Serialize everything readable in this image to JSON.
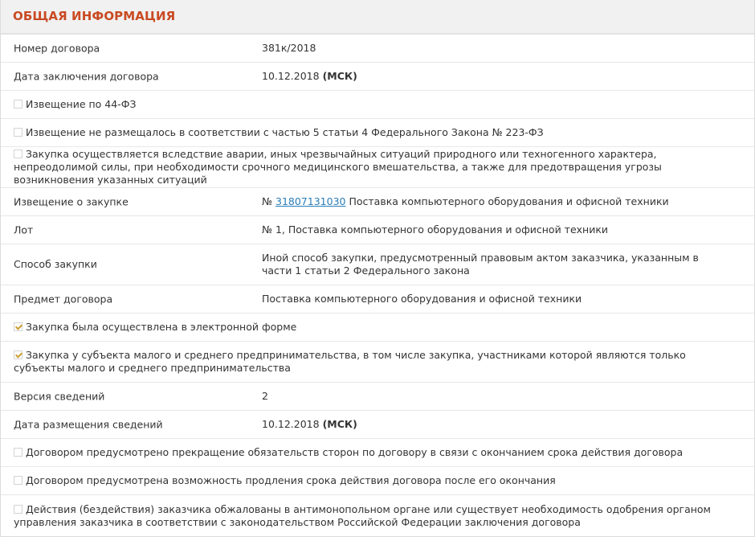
{
  "header": {
    "title": "ОБЩАЯ ИНФОРМАЦИЯ"
  },
  "rows": {
    "contract_number": {
      "label": "Номер договора",
      "value": "381к/2018"
    },
    "contract_date": {
      "label": "Дата заключения договора",
      "date": "10.12.2018",
      "tz": "(МСК)"
    },
    "notice_44": {
      "text": "Извещение по 44-ФЗ",
      "checked": false
    },
    "notice_not_posted": {
      "text": "Извещение не размещалось в соответствии с частью 5 статьи 4 Федерального Закона № 223-ФЗ",
      "checked": false
    },
    "emergency": {
      "text": "Закупка осуществляется вследствие аварии, иных чрезвычайных ситуаций природного или техногенного характера, непреодолимой силы, при необходимости срочного медицинского вмешательства, а также для предотвращения угрозы возникновения указанных ситуаций",
      "checked": false
    },
    "purchase_notice": {
      "label": "Извещение о закупке",
      "prefix": "№",
      "link": "31807131030",
      "text": "Поставка компьютерного оборудования и офисной техники"
    },
    "lot": {
      "label": "Лот",
      "value": "№ 1, Поставка компьютерного оборудования и офисной техники"
    },
    "method": {
      "label": "Способ закупки",
      "value": "Иной способ закупки, предусмотренный правовым актом заказчика, указанным в части 1 статьи 2 Федерального закона"
    },
    "subject": {
      "label": "Предмет договора",
      "value": "Поставка компьютерного оборудования и офисной техники"
    },
    "electronic": {
      "text": "Закупка была осуществлена в электронной форме",
      "checked": true
    },
    "sme": {
      "text": "Закупка у субъекта малого и среднего предпринимательства, в том числе закупка, участниками которой являются только субъекты малого и среднего предпринимательства",
      "checked": true
    },
    "version": {
      "label": "Версия сведений",
      "value": "2"
    },
    "posting_date": {
      "label": "Дата размещения сведений",
      "date": "10.12.2018",
      "tz": "(МСК)"
    },
    "termination": {
      "text": "Договором предусмотрено прекращение обязательств сторон по договору в связи с окончанием срока действия договора",
      "checked": false
    },
    "extension": {
      "text": "Договором предусмотрена возможность продления срока действия договора после его окончания",
      "checked": false
    },
    "appeal": {
      "text": "Действия (бездействия) заказчика обжалованы в антимонопольном органе или существует необходимость одобрения органом управления заказчика в соответствии с законодательством Российской Федерации заключения договора",
      "checked": false
    }
  },
  "colors": {
    "title": "#c94a23",
    "link": "#2a7db8",
    "checkmark": "#c9a033"
  }
}
